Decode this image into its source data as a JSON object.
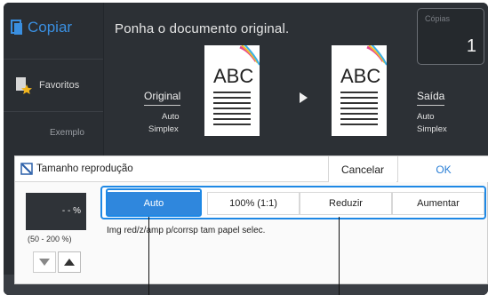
{
  "app": {
    "title": "Copiar",
    "icon": "copy-icon"
  },
  "sidebar": {
    "favorites_label": "Favoritos",
    "exemplo_label": "Exemplo"
  },
  "main": {
    "message": "Ponha o documento original.",
    "copies_label": "Cópias",
    "copies_value": "1",
    "original": {
      "heading": "Original",
      "line1": "Auto",
      "line2": "Simplex"
    },
    "output": {
      "heading": "Saída",
      "line1": "Auto",
      "line2": "Simplex"
    },
    "doc_text": "ABC"
  },
  "dialog": {
    "title": "Tamanho reprodução",
    "cancel_label": "Cancelar",
    "ok_label": "OK",
    "value_display": "- - %",
    "range_text": "(50 - 200 %)",
    "options": [
      "Auto",
      "100% (1:1)",
      "Reduzir",
      "Aumentar"
    ],
    "selected_option": "Auto",
    "hint": "Img red/z/amp p/corrsp tam papel selec."
  },
  "colors": {
    "accent": "#1e88e5",
    "selected_bg": "#2f87dd",
    "dark_bg": "#2c3035"
  }
}
